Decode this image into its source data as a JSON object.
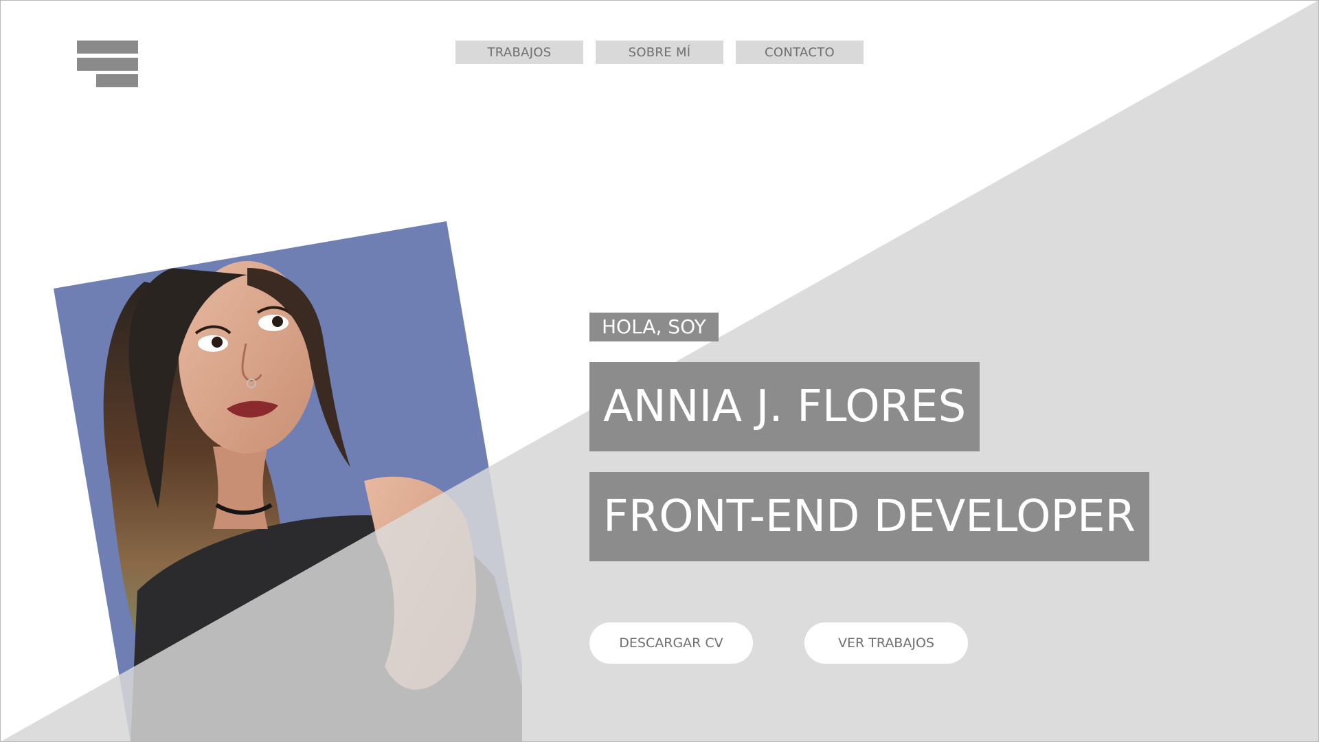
{
  "nav": {
    "items": [
      {
        "label": "TRABAJOS"
      },
      {
        "label": "SOBRE MÍ"
      },
      {
        "label": "CONTACTO"
      }
    ]
  },
  "hero": {
    "greeting": "HOLA, SOY",
    "name": "ANNIA J. FLORES",
    "role": "FRONT-END DEVELOPER"
  },
  "buttons": {
    "download_cv": "DESCARGAR CV",
    "view_works": "VER TRABAJOS"
  },
  "colors": {
    "page_background": "#ffffff",
    "diagonal_panel": "#dcdcdc",
    "label_box": "#8c8c8c",
    "nav_button": "#d9d9d9",
    "nav_text": "#6f6f6f",
    "photo_background": "#6f7fb3"
  },
  "icons": {
    "logo": "hamburger-menu-icon"
  }
}
